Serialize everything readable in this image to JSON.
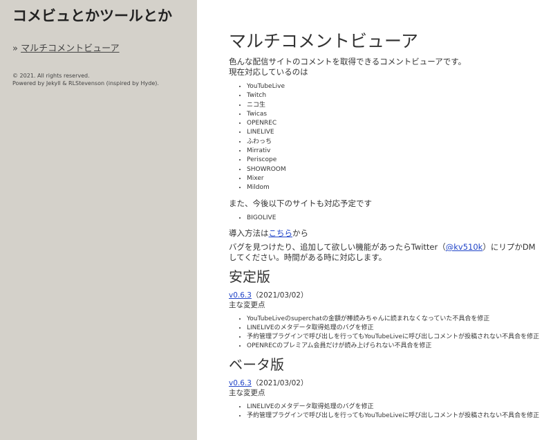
{
  "sidebar": {
    "site_title": "コメビュとかツールとか",
    "nav_prefix": "»",
    "nav_link": "マルチコメントビューア",
    "copyright": "© 2021. All rights reserved.",
    "powered": "Powered by Jekyll & RLStevenson (inspired by Hyde)."
  },
  "main": {
    "title": "マルチコメントビューア",
    "intro_1": "色んな配信サイトのコメントを取得できるコメントビューアです。",
    "intro_2": "現在対応しているのは",
    "supported_sites": [
      "YouTubeLive",
      "Twitch",
      "ニコ生",
      "Twicas",
      "OPENREC",
      "LINELIVE",
      "ふわっち",
      "Mirrativ",
      "Periscope",
      "SHOWROOM",
      "Mixer",
      "Mildom"
    ],
    "planned_intro": "また、今後以下のサイトも対応予定です",
    "planned_sites": [
      "BIGOLIVE"
    ],
    "install_prefix": "導入方法は",
    "install_link": "こちら",
    "install_suffix": "から",
    "bug_text_1": "バグを見つけたり、追加して欲しい機能があったらTwitter（",
    "bug_twitter": "@kv510k",
    "bug_text_2": "）にリプかDMしてください。時間がある時に対応します。",
    "stable": {
      "heading": "安定版",
      "version": "v0.6.3",
      "date": "（2021/03/02）",
      "changes_label": "主な変更点",
      "changes": [
        "YouTubeLiveのsuperchatの金額が棒読みちゃんに読まれなくなっていた不具合を修正",
        "LINELIVEのメタデータ取得処理のバグを修正",
        "予約管理プラグインで呼び出しを行ってもYouTubeLiveに呼び出しコメントが投稿されない不具合を修正",
        "OPENRECのプレミアム会員だけが読み上げられない不具合を修正"
      ]
    },
    "beta": {
      "heading": "ベータ版",
      "version": "v0.6.3",
      "date": "（2021/03/02）",
      "changes_label": "主な変更点",
      "changes": [
        "LINELIVEのメタデータ取得処理のバグを修正",
        "予約管理プラグインで呼び出しを行ってもYouTubeLiveに呼び出しコメントが投稿されない不具合を修正"
      ]
    }
  }
}
